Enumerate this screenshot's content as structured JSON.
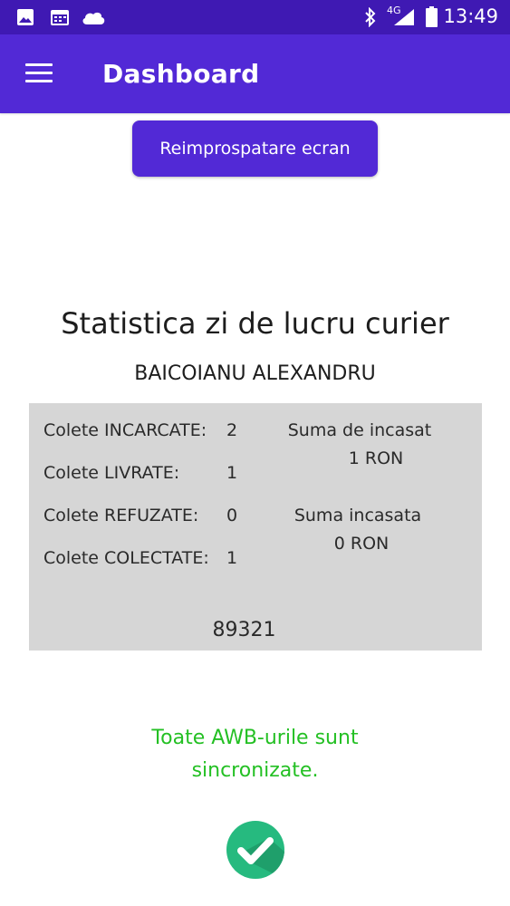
{
  "status_bar": {
    "time": "13:49",
    "network": "4G",
    "icons": [
      "image-icon",
      "calendar-icon",
      "cloud-icon",
      "bluetooth-icon",
      "signal-icon",
      "battery-icon"
    ]
  },
  "app_bar": {
    "title": "Dashboard",
    "menu_icon": "hamburger-menu-icon"
  },
  "refresh_button": {
    "label": "Reimprospatare ecran"
  },
  "stats": {
    "title": "Statistica zi de lucru curier",
    "courier_name": "BAICOIANU ALEXANDRU",
    "rows": [
      {
        "label": "Colete INCARCATE:",
        "value": "2"
      },
      {
        "label": "Colete LIVRATE:",
        "value": "1"
      },
      {
        "label": "Colete REFUZATE:",
        "value": "0"
      },
      {
        "label": "Colete COLECTATE:",
        "value": "1"
      }
    ],
    "to_collect": {
      "label": "Suma de incasat",
      "value": "1 RON"
    },
    "collected": {
      "label": "Suma incasata",
      "value": "0 RON"
    },
    "code": "89321"
  },
  "sync": {
    "line1": "Toate AWB-urile sunt",
    "line2": "sincronizate.",
    "icon": "check-circle-icon"
  },
  "colors": {
    "status_bar": "#3f19b3",
    "app_bar": "#5229d6",
    "button": "#5229d6",
    "panel_bg": "#d6d6d6",
    "success_text": "#24c024",
    "success_icon": "#26ba7f"
  }
}
